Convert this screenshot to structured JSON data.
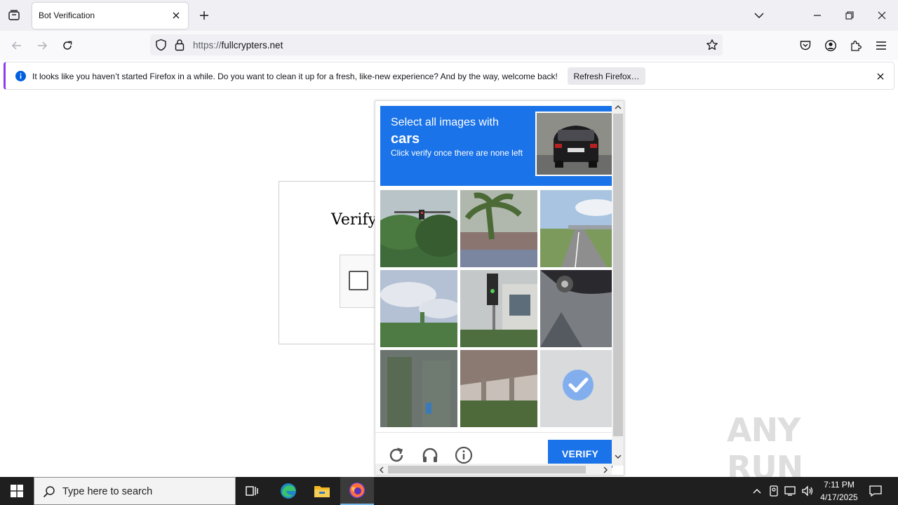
{
  "browser": {
    "tab_title": "Bot Verification",
    "url_prefix": "https://",
    "url_domain": "fullcrypters.net"
  },
  "notification": {
    "message": "It looks like you haven’t started Firefox in a while. Do you want to clean it up for a fresh, like-new experience? And by the way, welcome back!",
    "button_label": "Refresh Firefox…"
  },
  "page": {
    "heading": "Verifyi"
  },
  "captcha": {
    "instruction_line1": "Select all images with",
    "target_object": "cars",
    "instruction_line2": "Click verify once there are none left",
    "verify_label": "VERIFY",
    "accent_color": "#1a73e8"
  },
  "watermark": {
    "text": "ANY RUN"
  },
  "taskbar": {
    "search_placeholder": "Type here to search",
    "time": "7:11 PM",
    "date": "4/17/2025"
  }
}
